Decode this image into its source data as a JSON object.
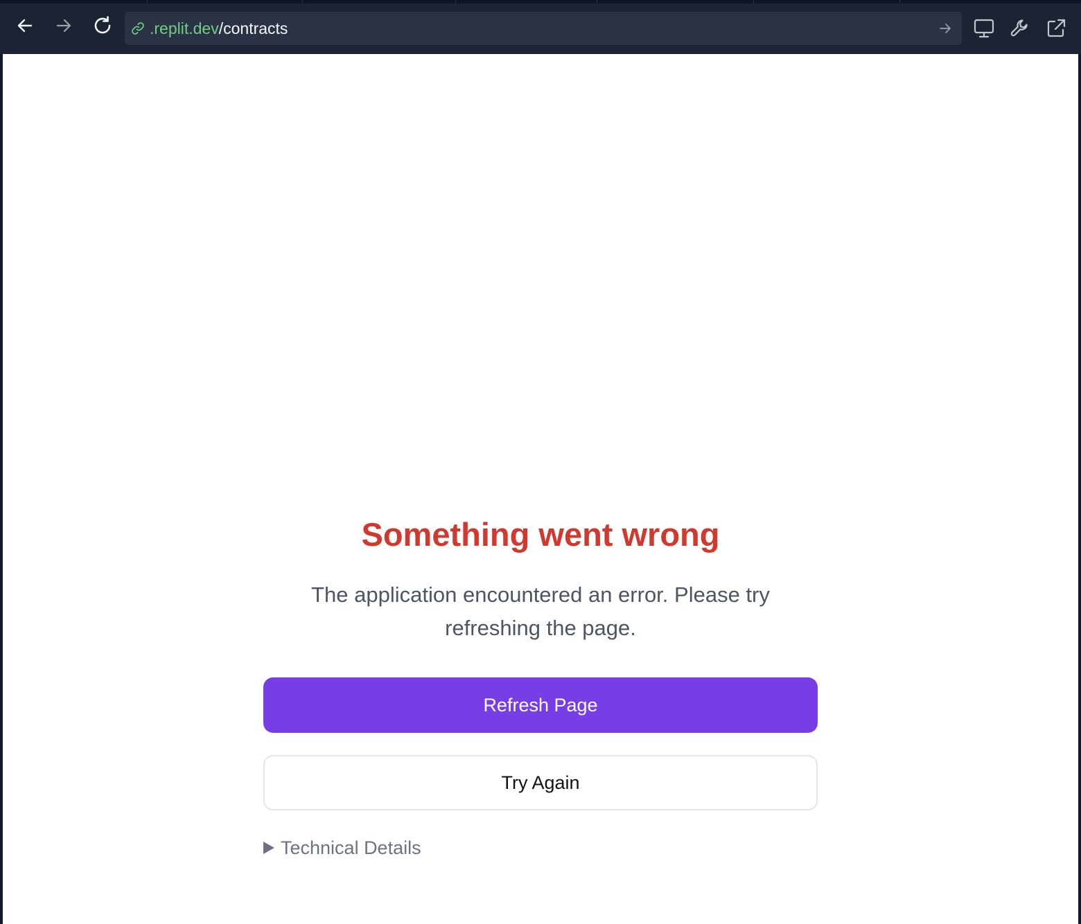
{
  "browser": {
    "url": {
      "domain": ".replit.dev",
      "path": "/contracts"
    },
    "icons": {
      "back": "arrow-left-icon",
      "forward": "arrow-right-icon",
      "reload": "reload-icon",
      "link": "link-icon",
      "go": "arrow-right-icon",
      "devices": "monitor-icon",
      "devtools": "wrench-icon",
      "open_external": "external-link-icon"
    }
  },
  "error": {
    "title": "Something went wrong",
    "message": "The application encountered an error. Please try refreshing the page.",
    "refresh_label": "Refresh Page",
    "retry_label": "Try Again",
    "details_label": "Technical Details"
  },
  "colors": {
    "title_red": "#d0392e",
    "primary_purple": "#773ee5",
    "url_domain_green": "#6fcf7f",
    "toolbar_bg": "#1c2333",
    "urlbar_bg": "#2b3245"
  }
}
